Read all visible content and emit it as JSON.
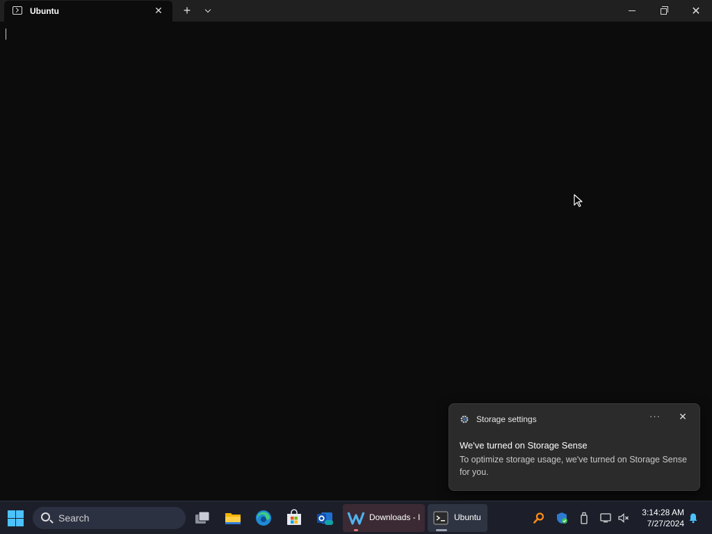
{
  "window": {
    "tab_title": "Ubuntu",
    "tab_close": "✕",
    "new_tab": "+",
    "close": "✕"
  },
  "toast": {
    "app_name": "Storage settings",
    "more": "···",
    "close": "✕",
    "title": "We've turned on Storage Sense",
    "body": "To optimize storage usage, we've turned on Storage Sense for you."
  },
  "taskbar": {
    "search_placeholder": "Search",
    "apps": [
      {
        "name": "task-view",
        "icon": "task-view-icon"
      },
      {
        "name": "file-explorer",
        "icon": "folder-icon"
      },
      {
        "name": "edge",
        "icon": "edge-icon"
      },
      {
        "name": "store",
        "icon": "store-icon"
      },
      {
        "name": "outlook",
        "icon": "outlook-icon"
      }
    ],
    "downloads_label": "Downloads - I",
    "ubuntu_label": "Ubuntu",
    "time": "3:14:28 AM",
    "date": "7/27/2024"
  },
  "colors": {
    "accent": "#4cc2ff",
    "terminal_bg": "#0c0c0c",
    "taskbar_bg": "#1c1f2a"
  }
}
